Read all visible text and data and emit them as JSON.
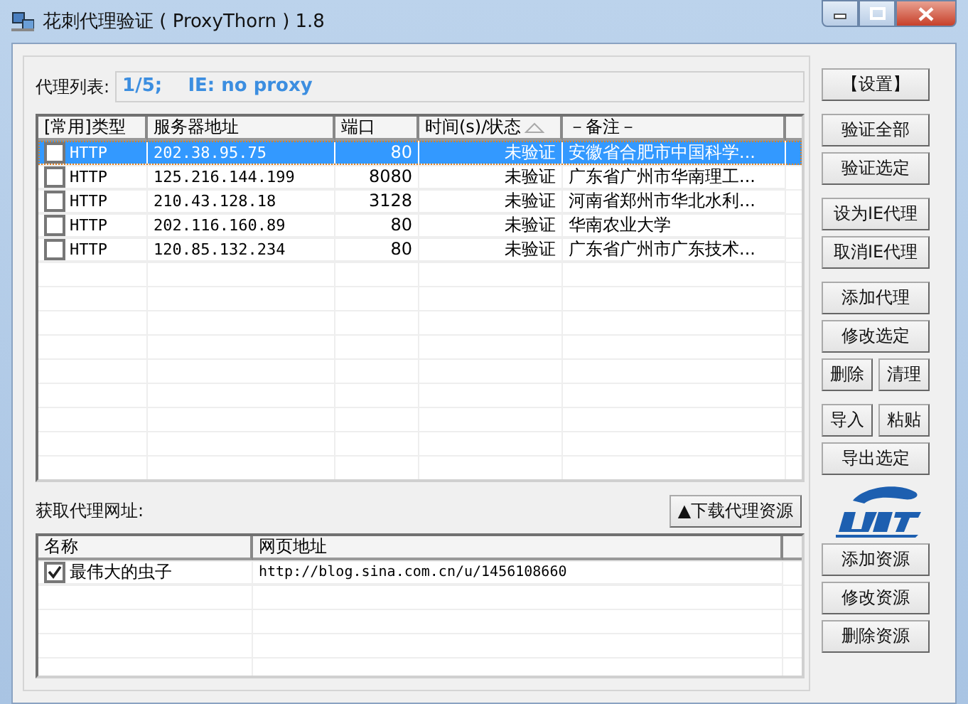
{
  "window": {
    "title": "花刺代理验证 ( ProxyThorn ) 1.8"
  },
  "proxy_list": {
    "label": "代理列表:",
    "status": "1/5;    IE: no proxy",
    "columns": [
      {
        "label": "[常用]类型",
        "sorted": false
      },
      {
        "label": "服务器地址",
        "sorted": false
      },
      {
        "label": "端口",
        "sorted": false
      },
      {
        "label": "时间(s)/状态",
        "sorted": true
      },
      {
        "label": "－备注－",
        "sorted": false
      }
    ],
    "rows": [
      {
        "selected": true,
        "checked": false,
        "type": "HTTP",
        "address": "202.38.95.75",
        "port": "80",
        "status": "未验证",
        "note": "安徽省合肥市中国科学..."
      },
      {
        "selected": false,
        "checked": false,
        "type": "HTTP",
        "address": "125.216.144.199",
        "port": "8080",
        "status": "未验证",
        "note": "广东省广州市华南理工..."
      },
      {
        "selected": false,
        "checked": false,
        "type": "HTTP",
        "address": "210.43.128.18",
        "port": "3128",
        "status": "未验证",
        "note": "河南省郑州市华北水利..."
      },
      {
        "selected": false,
        "checked": false,
        "type": "HTTP",
        "address": "202.116.160.89",
        "port": "80",
        "status": "未验证",
        "note": "华南农业大学"
      },
      {
        "selected": false,
        "checked": false,
        "type": "HTTP",
        "address": "120.85.132.234",
        "port": "80",
        "status": "未验证",
        "note": "广东省广州市广东技术..."
      }
    ]
  },
  "sources": {
    "label": "获取代理网址:",
    "download_button": "▲下载代理资源",
    "columns": [
      "名称",
      "网页地址"
    ],
    "rows": [
      {
        "checked": true,
        "name": "最伟大的虫子",
        "url": "http://blog.sina.com.cn/u/1456108660"
      }
    ]
  },
  "side_groups": [
    [
      {
        "label": "【设置】",
        "kind": "full"
      }
    ],
    [
      {
        "label": "验证全部",
        "kind": "full"
      },
      {
        "label": "验证选定",
        "kind": "full"
      }
    ],
    [
      {
        "label": "设为IE代理",
        "kind": "full"
      },
      {
        "label": "取消IE代理",
        "kind": "full"
      }
    ],
    [
      {
        "label": "添加代理",
        "kind": "full"
      },
      {
        "label": "修改选定",
        "kind": "full"
      },
      {
        "label": "删除",
        "kind": "half"
      },
      {
        "label": "清理",
        "kind": "half"
      }
    ],
    [
      {
        "label": "导入",
        "kind": "half"
      },
      {
        "label": "粘贴",
        "kind": "half"
      },
      {
        "label": "导出选定",
        "kind": "full"
      },
      {
        "kind": "logo"
      },
      {
        "label": "添加资源",
        "kind": "full"
      },
      {
        "label": "修改资源",
        "kind": "full"
      },
      {
        "label": "删除资源",
        "kind": "full"
      }
    ]
  ]
}
